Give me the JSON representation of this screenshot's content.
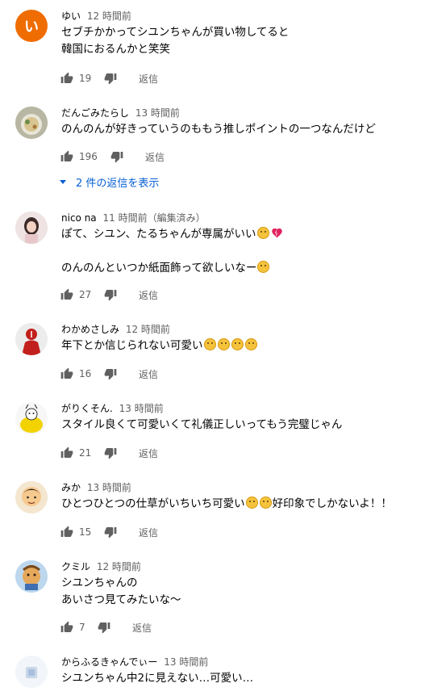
{
  "comments": [
    {
      "avatar_letter": "い",
      "author": "ゆい",
      "time": "12 時間前",
      "lines": [
        "セブチかかってシユンちゃんが買い物してると",
        "韓国におるんかと笑笑"
      ],
      "likes": "19",
      "reply": "返信"
    },
    {
      "author": "だんごみたらし",
      "time": "13 時間前",
      "lines": [
        "のんのんが好きっていうのももう推しポイントの一つなんだけど"
      ],
      "likes": "196",
      "reply": "返信",
      "replies_label": "2 件の返信を表示"
    },
    {
      "author": "nico na",
      "time": "11 時間前（編集済み）",
      "lines": [
        "ぽて、シユン、たるちゃんが専属がいい",
        "",
        "のんのんといつか紙面飾って欲しいなー"
      ],
      "likes": "27",
      "reply": "返信"
    },
    {
      "author": "わかめさしみ",
      "time": "12 時間前",
      "lines": [
        "年下とか信じられない可愛い"
      ],
      "likes": "16",
      "reply": "返信"
    },
    {
      "author": "がりくそん.",
      "time": "13 時間前",
      "lines": [
        "スタイル良くて可愛いくて礼儀正しいってもう完璧じゃん"
      ],
      "likes": "21",
      "reply": "返信"
    },
    {
      "author": "みか",
      "time": "13 時間前",
      "lines": [
        "ひとつひとつの仕草がいちいち可愛い",
        "好印象でしかないよ！！"
      ],
      "likes": "15",
      "reply": "返信"
    },
    {
      "author": "クミル",
      "time": "12 時間前",
      "lines": [
        "シユンちゃんの",
        "あいさつ見てみたいな〜"
      ],
      "likes": "7",
      "reply": "返信"
    },
    {
      "author": "からふるきゃんでぃー",
      "time": "13 時間前",
      "lines": [
        "シユンちゃん中2に見えない…可愛い…"
      ]
    }
  ],
  "colors": {
    "text": "#030303",
    "secondary": "#606060",
    "link": "#065fd4",
    "avatar_orange": "#ef6c00"
  },
  "icons": [
    "thumb-up-icon",
    "thumb-down-icon",
    "chevron-down-icon",
    "emoji-icon"
  ]
}
